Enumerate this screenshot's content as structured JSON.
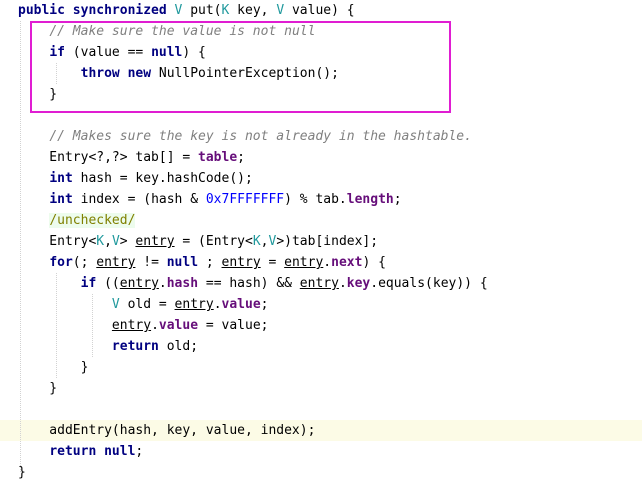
{
  "colors": {
    "keyword": "#000080",
    "type_param": "#20999d",
    "field": "#660e7a",
    "number": "#0000ff",
    "comment": "#808080",
    "annotation_bg": "#edfced",
    "highlight_border": "#e01dd2",
    "current_line_bg": "#fcfbe6"
  },
  "code": {
    "lines": [
      [
        {
          "t": "public synchronized",
          "c": "kw"
        },
        {
          "t": " "
        },
        {
          "t": "V",
          "c": "tp"
        },
        {
          "t": " put("
        },
        {
          "t": "K",
          "c": "tp"
        },
        {
          "t": " key, "
        },
        {
          "t": "V",
          "c": "tp"
        },
        {
          "t": " value) {"
        }
      ],
      [
        {
          "t": "    "
        },
        {
          "t": "// Make sure the value is not null",
          "c": "cm"
        }
      ],
      [
        {
          "t": "    "
        },
        {
          "t": "if",
          "c": "kw"
        },
        {
          "t": " (value == "
        },
        {
          "t": "null",
          "c": "kw"
        },
        {
          "t": ") {"
        }
      ],
      [
        {
          "t": "        "
        },
        {
          "t": "throw new",
          "c": "kw"
        },
        {
          "t": " NullPointerException();"
        }
      ],
      [
        {
          "t": "    }"
        }
      ],
      [],
      [
        {
          "t": "    "
        },
        {
          "t": "// Makes sure the key is not already in the hashtable.",
          "c": "cm"
        }
      ],
      [
        {
          "t": "    Entry<?,?> tab[] = "
        },
        {
          "t": "table",
          "c": "fl"
        },
        {
          "t": ";"
        }
      ],
      [
        {
          "t": "    "
        },
        {
          "t": "int",
          "c": "kw"
        },
        {
          "t": " hash = key.hashCode();"
        }
      ],
      [
        {
          "t": "    "
        },
        {
          "t": "int",
          "c": "kw"
        },
        {
          "t": " index = (hash & "
        },
        {
          "t": "0x7FFFFFFF",
          "c": "nm"
        },
        {
          "t": ") % tab."
        },
        {
          "t": "length",
          "c": "fl"
        },
        {
          "t": ";"
        }
      ],
      [
        {
          "t": "    "
        },
        {
          "t": "/unchecked/",
          "c": "tag"
        }
      ],
      [
        {
          "t": "    Entry<"
        },
        {
          "t": "K",
          "c": "tp"
        },
        {
          "t": ","
        },
        {
          "t": "V",
          "c": "tp"
        },
        {
          "t": "> "
        },
        {
          "t": "entry",
          "c": "uv"
        },
        {
          "t": " = (Entry<"
        },
        {
          "t": "K",
          "c": "tp"
        },
        {
          "t": ","
        },
        {
          "t": "V",
          "c": "tp"
        },
        {
          "t": ">)tab[index];"
        }
      ],
      [
        {
          "t": "    "
        },
        {
          "t": "for",
          "c": "kw"
        },
        {
          "t": "(; "
        },
        {
          "t": "entry",
          "c": "uv"
        },
        {
          "t": " != "
        },
        {
          "t": "null",
          "c": "kw"
        },
        {
          "t": " ; "
        },
        {
          "t": "entry",
          "c": "uv"
        },
        {
          "t": " = "
        },
        {
          "t": "entry",
          "c": "uv"
        },
        {
          "t": "."
        },
        {
          "t": "next",
          "c": "fl"
        },
        {
          "t": ") {"
        }
      ],
      [
        {
          "t": "        "
        },
        {
          "t": "if",
          "c": "kw"
        },
        {
          "t": " (("
        },
        {
          "t": "entry",
          "c": "uv"
        },
        {
          "t": "."
        },
        {
          "t": "hash",
          "c": "fl"
        },
        {
          "t": " == hash) && "
        },
        {
          "t": "entry",
          "c": "uv"
        },
        {
          "t": "."
        },
        {
          "t": "key",
          "c": "fl"
        },
        {
          "t": ".equals(key)) {"
        }
      ],
      [
        {
          "t": "            "
        },
        {
          "t": "V",
          "c": "tp"
        },
        {
          "t": " old = "
        },
        {
          "t": "entry",
          "c": "uv"
        },
        {
          "t": "."
        },
        {
          "t": "value",
          "c": "fl"
        },
        {
          "t": ";"
        }
      ],
      [
        {
          "t": "            "
        },
        {
          "t": "entry",
          "c": "uv"
        },
        {
          "t": "."
        },
        {
          "t": "value",
          "c": "fl"
        },
        {
          "t": " = value;"
        }
      ],
      [
        {
          "t": "            "
        },
        {
          "t": "return",
          "c": "kw"
        },
        {
          "t": " old;"
        }
      ],
      [
        {
          "t": "        }"
        }
      ],
      [
        {
          "t": "    }"
        }
      ],
      [],
      [
        {
          "t": "    addEntry(hash, key, value, index);"
        }
      ],
      [
        {
          "t": "    "
        },
        {
          "t": "return null",
          "c": "kw"
        },
        {
          "t": ";"
        }
      ],
      [
        {
          "t": "}"
        }
      ]
    ],
    "current_line": 20,
    "highlighted_lines": [
      1,
      4
    ]
  }
}
